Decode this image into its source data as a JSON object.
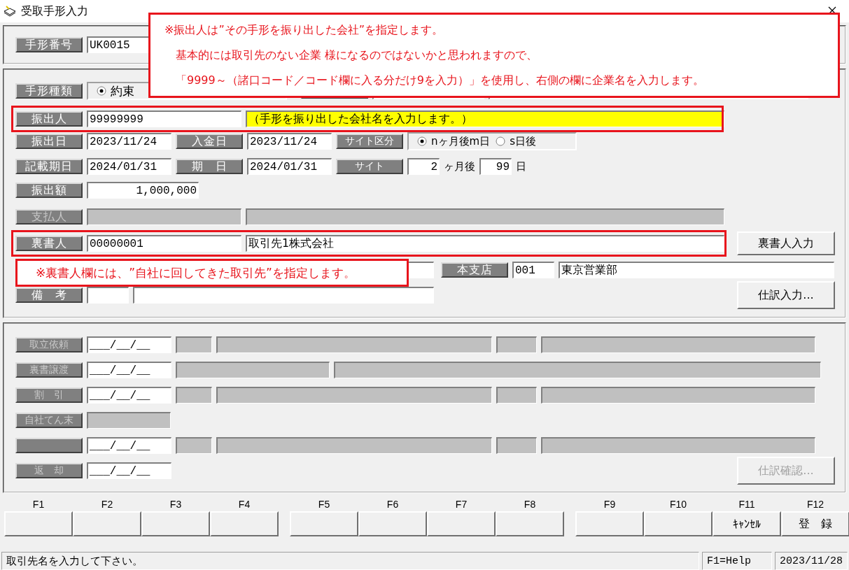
{
  "window": {
    "title": "受取手形入力"
  },
  "note_top": {
    "lines": [
      "※振出人は”その手形を振り出した会社”を指定します。",
      "基本的には取引先のない企業 様になるのではないかと思われますので、",
      "「9999～（諸口コード／コード欄に入る分だけ9を入力）」を使用し、右側の欄に企業名を入力します。"
    ]
  },
  "note_endorser": {
    "text": "※裏書人欄には、”自社に回してきた取引先”を指定します。"
  },
  "bill_number": {
    "label": "手形番号",
    "value": "UK0015"
  },
  "bill_type": {
    "label": "手形種類",
    "options": [
      {
        "label": "約束",
        "selected": true
      }
    ]
  },
  "drawer": {
    "label": "振出人",
    "code": "99999999",
    "name": "（手形を振り出した会社名を入力します。）",
    "highlighted": true
  },
  "issue_date": {
    "label": "振出日",
    "value": "2023/11/24"
  },
  "deposit_date": {
    "label": "入金日",
    "value": "2023/11/24"
  },
  "site_type": {
    "label": "サイト区分",
    "options": [
      {
        "label": "nヶ月後m日",
        "selected": true
      },
      {
        "label": "s日後",
        "selected": false
      }
    ]
  },
  "record_due": {
    "label": "記載期日",
    "value": "2024/01/31"
  },
  "due": {
    "label": "期　日",
    "value": "2024/01/31"
  },
  "site": {
    "label": "サイト",
    "months": "2",
    "months_unit": "ヶ月後",
    "days": "99",
    "days_unit": "日"
  },
  "amount": {
    "label": "振出額",
    "value": "1,000,000"
  },
  "payer": {
    "label": "支払人",
    "disabled": true
  },
  "endorser": {
    "label": "裏書人",
    "code": "00000001",
    "name": "取引先1株式会社",
    "highlighted": true
  },
  "endorser_button": {
    "label": "裏書人入力"
  },
  "branch": {
    "label": "本支店",
    "code": "001",
    "name": "東京営業部"
  },
  "remarks": {
    "label": "備　考"
  },
  "journal_button": {
    "label": "仕訳入力...",
    "disabled": false
  },
  "history": [
    {
      "kind": "standard",
      "label": "取立依頼",
      "date": "___/__/__",
      "disabled": true
    },
    {
      "kind": "transfer",
      "label": "裏書譲渡",
      "date": "___/__/__",
      "disabled": true
    },
    {
      "kind": "standard",
      "label": "割　引",
      "date": "___/__/__",
      "disabled": true
    },
    {
      "kind": "single",
      "label": "自社てん末",
      "disabled": true
    },
    {
      "kind": "standard",
      "date": "___/__/__",
      "disabled": true
    },
    {
      "kind": "date_only",
      "label": "返　却",
      "date": "___/__/__",
      "disabled": true
    }
  ],
  "confirm_button": {
    "label": "仕訳確認...",
    "disabled": true
  },
  "function_keys": [
    {
      "key": "F1"
    },
    {
      "key": "F2"
    },
    {
      "key": "F3"
    },
    {
      "key": "F4"
    },
    {
      "key": "F5"
    },
    {
      "key": "F6"
    },
    {
      "key": "F7"
    },
    {
      "key": "F8"
    },
    {
      "key": "F9"
    },
    {
      "key": "F10"
    },
    {
      "key": "F11",
      "label": "ｷｬﾝｾﾙ"
    },
    {
      "key": "F12",
      "label": "登　録"
    }
  ],
  "status_bar": {
    "message": "取引先名を入力して下さい。",
    "help": "F1=Help",
    "date": "2023/11/28"
  }
}
